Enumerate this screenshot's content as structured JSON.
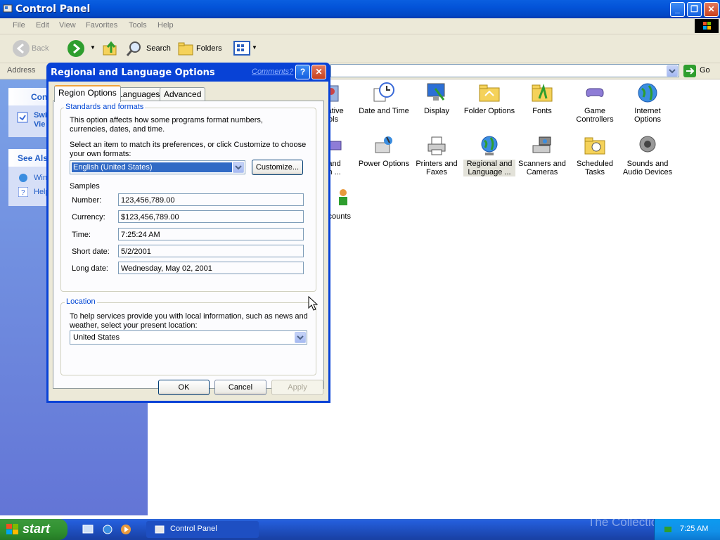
{
  "window": {
    "title": "Control Panel"
  },
  "menu": [
    "File",
    "Edit",
    "View",
    "Favorites",
    "Tools",
    "Help"
  ],
  "toolbar": {
    "back": "Back",
    "search": "Search",
    "folders": "Folders"
  },
  "address": {
    "label": "Address",
    "go": "Go"
  },
  "taskpane": {
    "panel_head": "Con",
    "switch_line1": "Swi",
    "switch_line2": "Vie",
    "see_also": "See Als",
    "item1": "Win",
    "item2": "Help"
  },
  "items": [
    {
      "label": "strative\nools",
      "icon": "admin-tools-icon"
    },
    {
      "label": "Date and Time",
      "icon": "clock-icon"
    },
    {
      "label": "Display",
      "icon": "display-icon"
    },
    {
      "label": "Folder Options",
      "icon": "folder-icon"
    },
    {
      "label": "Fonts",
      "icon": "fonts-folder-icon"
    },
    {
      "label": "Game\nControllers",
      "icon": "gamepad-icon"
    },
    {
      "label": "Internet\nOptions",
      "icon": "globe-icon"
    },
    {
      "label": "e and\nem ...",
      "icon": "system-icon"
    },
    {
      "label": "Power Options",
      "icon": "power-icon"
    },
    {
      "label": "Printers and\nFaxes",
      "icon": "printer-icon"
    },
    {
      "label": "Regional and\nLanguage ...",
      "icon": "world-icon"
    },
    {
      "label": "Scanners and\nCameras",
      "icon": "scanner-icon"
    },
    {
      "label": "Scheduled\nTasks",
      "icon": "scheduled-folder-icon"
    },
    {
      "label": "Sounds and\nAudio Devices",
      "icon": "speaker-icon"
    },
    {
      "label": "ccounts",
      "icon": "user-accounts-icon"
    }
  ],
  "dialog": {
    "title": "Regional and Language Options",
    "comments": "Comments?",
    "help_glyph": "?",
    "tabs": [
      "Region Options",
      "Languages",
      "Advanced"
    ],
    "standards_label": "Standards and formats",
    "standards_desc": "This option affects how some programs format numbers, currencies, dates, and time.",
    "select_desc": "Select an item to match its preferences, or click Customize to choose your own formats:",
    "format_value": "English (United States)",
    "customize": "Customize...",
    "samples_label": "Samples",
    "samples": [
      {
        "label": "Number:",
        "value": "123,456,789.00"
      },
      {
        "label": "Currency:",
        "value": "$123,456,789.00"
      },
      {
        "label": "Time:",
        "value": "7:25:24 AM"
      },
      {
        "label": "Short date:",
        "value": "5/2/2001"
      },
      {
        "label": "Long date:",
        "value": "Wednesday, May 02, 2001"
      }
    ],
    "location_label": "Location",
    "location_desc": "To help services provide you with local information, such as news and weather, select your present location:",
    "location_value": "United States",
    "ok": "OK",
    "cancel": "Cancel",
    "apply": "Apply"
  },
  "taskbar": {
    "start": "start",
    "task": "Control Panel",
    "clock": "7:25 AM",
    "watermark": "The Collection Book"
  }
}
